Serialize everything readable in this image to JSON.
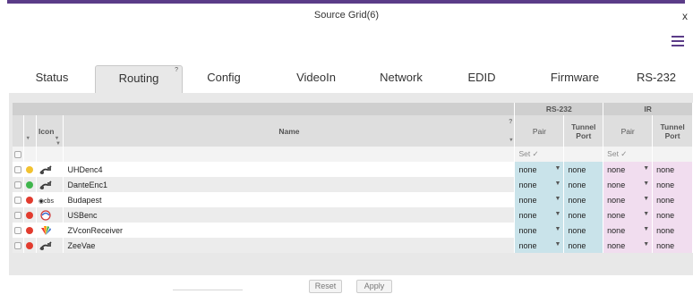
{
  "window": {
    "title": "Source Grid(6)",
    "close_glyph": "x"
  },
  "menu_icon": "hamburger-icon",
  "tabs": [
    {
      "label": "Status"
    },
    {
      "label": "Routing",
      "active": true,
      "help": "?"
    },
    {
      "label": "Config"
    },
    {
      "label": "VideoIn"
    },
    {
      "label": "Network"
    },
    {
      "label": "EDID"
    },
    {
      "label": "Firmware"
    },
    {
      "label": "RS-232"
    }
  ],
  "grid": {
    "group_headers": {
      "rs232": "RS-232",
      "ir": "IR"
    },
    "columns": {
      "icon": "Icon",
      "name": "Name",
      "pair": "Pair",
      "tunnel_port": "Tunnel\nPort",
      "ir_pair": "Pair",
      "ir_tunnel_port": "Tunnel\nPort",
      "help": "?"
    },
    "set_label": "Set ✓",
    "rows": [
      {
        "status": "yellow",
        "icon": "plug-icon",
        "name": "UHDenc4",
        "rs_pair": "none",
        "rs_tunnel": "none",
        "ir_pair": "none",
        "ir_tunnel": "none"
      },
      {
        "status": "green",
        "icon": "plug-icon",
        "name": "DanteEnc1",
        "rs_pair": "none",
        "rs_tunnel": "none",
        "ir_pair": "none",
        "ir_tunnel": "none"
      },
      {
        "status": "red",
        "icon": "cbs-logo-icon",
        "icon_text": "◉cbs",
        "name": "Budapest",
        "rs_pair": "none",
        "rs_tunnel": "none",
        "ir_pair": "none",
        "ir_tunnel": "none"
      },
      {
        "status": "red",
        "icon": "cnn-logo-icon",
        "name": "USBenc",
        "rs_pair": "none",
        "rs_tunnel": "none",
        "ir_pair": "none",
        "ir_tunnel": "none"
      },
      {
        "status": "red",
        "icon": "nbc-peacock-icon",
        "name": "ZVconReceiver",
        "rs_pair": "none",
        "rs_tunnel": "none",
        "ir_pair": "none",
        "ir_tunnel": "none"
      },
      {
        "status": "red",
        "icon": "plug-icon",
        "name": "ZeeVae",
        "rs_pair": "none",
        "rs_tunnel": "none",
        "ir_pair": "none",
        "ir_tunnel": "none"
      }
    ]
  },
  "buttons": {
    "reset": "Reset",
    "apply": "Apply"
  },
  "colors": {
    "yellow": "#f2c230",
    "green": "#3fb54c",
    "red": "#e23b2e",
    "accent": "#5b3c88"
  }
}
